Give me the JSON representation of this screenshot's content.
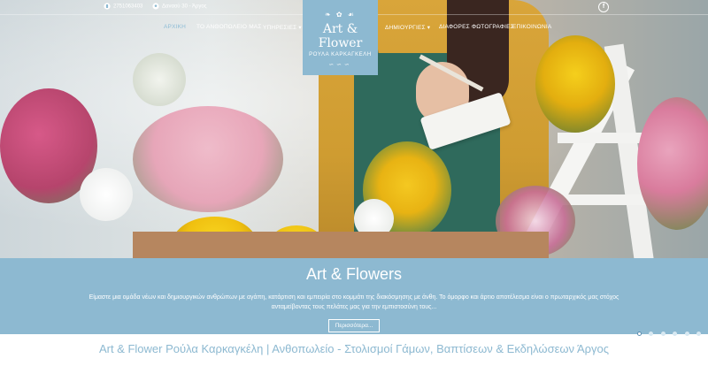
{
  "topbar": {
    "phone": "2751063403",
    "address": "Δαναού 30 - Άργος"
  },
  "nav": {
    "items": [
      {
        "label": "ΑΡΧΙΚΗ",
        "active": true
      },
      {
        "label": "ΤΟ ΑΝΘΟΠΩΛΕΙΟ ΜΑΣ"
      },
      {
        "label": "ΥΠΗΡΕΣΙΕΣ ▾"
      },
      {
        "label": "ΔΗΜΙΟΥΡΓΙΕΣ ▾"
      },
      {
        "label": "ΔΙΑΦΟΡΕΣ ΦΩΤΟΓΡΑΦΙΕΣ"
      },
      {
        "label": "ΕΠΙΚΟΙΝΩΝΙΑ"
      }
    ],
    "social_icon": "facebook-icon",
    "social_glyph": "f"
  },
  "logo": {
    "name": "Art & Flower",
    "subtitle": "ΡΟΥΛΑ ΚΑΡΚΑΓΚΕΛΗ"
  },
  "slider": {
    "title": "Art & Flowers",
    "text": "Είμαστε μια ομάδα νέων και δημιουργικών ανθρώπων με αγάπη, κατάρτιση και εμπειρία στο κομμάτι της διακόσμησης με άνθη. Το όμορφο και άρτιο αποτέλεσμα είναι ο πρωταρχικός μας στόχος ανταμείβοντας τους πελάτες μας για την εμπιστοσύνη τους...",
    "button_label": "Περισσότερα...",
    "slide_count": 6,
    "active_slide": 1
  },
  "page_heading": "Art & Flower Ρούλα Καρκαγκέλη | Ανθοπωλείο - Στολισμοί Γάμων, Βαπτίσεων & Εκδηλώσεων Άργος",
  "colors": {
    "accent": "#8db9d1",
    "active_nav": "#8fbcd6"
  }
}
